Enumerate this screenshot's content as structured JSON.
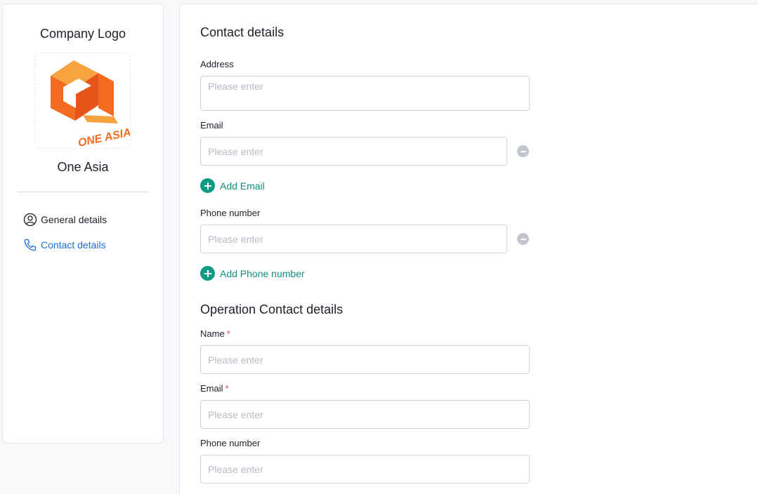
{
  "sidebar": {
    "logo_title": "Company Logo",
    "logo_text": "ONE ASIA",
    "company_name": "One Asia",
    "nav": [
      {
        "label": "General details",
        "icon": "user-circle-icon",
        "active": false
      },
      {
        "label": "Contact details",
        "icon": "phone-icon",
        "active": true
      }
    ]
  },
  "contact": {
    "title": "Contact details",
    "address_label": "Address",
    "address_placeholder": "Please enter",
    "email_label": "Email",
    "email_placeholder": "Please enter",
    "add_email_label": "Add Email",
    "phone_label": "Phone number",
    "phone_placeholder": "Please enter",
    "add_phone_label": "Add Phone number"
  },
  "operation": {
    "title": "Operation Contact details",
    "name_label": "Name",
    "name_placeholder": "Please enter",
    "email_label": "Email",
    "email_placeholder": "Please enter",
    "phone_label": "Phone number",
    "phone_placeholder": "Please enter",
    "required_mark": "*"
  },
  "colors": {
    "accent_blue": "#1a6fd6",
    "accent_green": "#0f9b83",
    "logo_orange": "#f26b21",
    "required_red": "#e5484d"
  }
}
